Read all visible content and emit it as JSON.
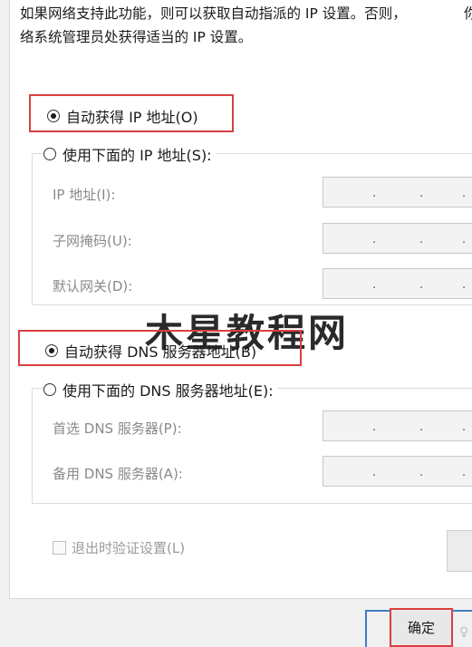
{
  "description": {
    "line1": "如果网络支持此功能，则可以获取自动指派的 IP 设置。否则，",
    "line2": "络系统管理员处获得适当的 IP 设置。",
    "cut_char": "你"
  },
  "ip_section": {
    "auto_option": {
      "label": "自动获得 IP 地址(O)",
      "selected": true
    },
    "manual_option": {
      "label": "使用下面的 IP 地址(S):",
      "selected": false
    },
    "fields": [
      {
        "label": "IP 地址(I):",
        "value": ""
      },
      {
        "label": "子网掩码(U):",
        "value": ""
      },
      {
        "label": "默认网关(D):",
        "value": ""
      }
    ]
  },
  "dns_section": {
    "auto_option": {
      "label": "自动获得 DNS 服务器地址(B)",
      "selected": true
    },
    "manual_option": {
      "label": "使用下面的 DNS 服务器地址(E):",
      "selected": false
    },
    "fields": [
      {
        "label": "首选 DNS 服务器(P):",
        "value": ""
      },
      {
        "label": "备用 DNS 服务器(A):",
        "value": ""
      }
    ]
  },
  "validate_on_exit": {
    "label": "退出时验证设置(L)",
    "checked": false
  },
  "buttons": {
    "ok_label": "确定"
  },
  "watermark": "木星教程网",
  "colors": {
    "highlight": "#d84040",
    "focus": "#3c7fc4",
    "panel": "#ffffff",
    "window": "#f0f0f0"
  }
}
